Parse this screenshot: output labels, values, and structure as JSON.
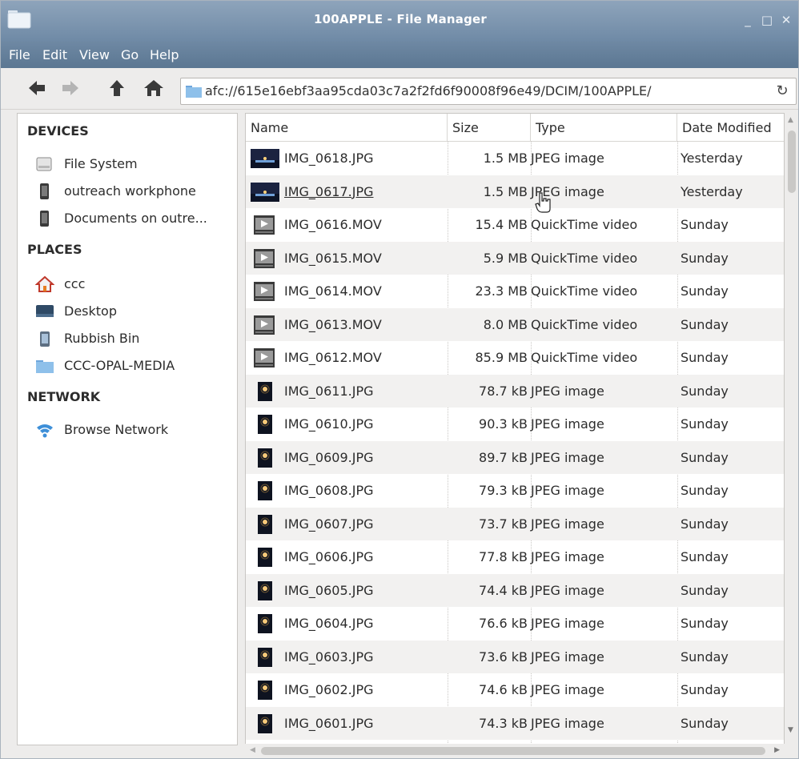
{
  "window": {
    "title": "100APPLE - File Manager",
    "min_glyph": "_",
    "max_glyph": "□",
    "close_glyph": "✕"
  },
  "menubar": {
    "items": [
      "File",
      "Edit",
      "View",
      "Go",
      "Help"
    ]
  },
  "toolbar": {
    "back_icon": "back-arrow-icon",
    "forward_icon": "forward-arrow-icon",
    "up_icon": "up-arrow-icon",
    "home_icon": "home-icon",
    "address": "afc://615e16ebf3aa95cda03c7a2f2fd6f90008f96e49/DCIM/100APPLE/",
    "reload_glyph": "↻"
  },
  "sidebar": {
    "devices_heading": "DEVICES",
    "devices": [
      {
        "label": "File System",
        "icon": "drive-icon"
      },
      {
        "label": "outreach workphone",
        "icon": "phone-icon"
      },
      {
        "label": "Documents on outre...",
        "icon": "phone-icon"
      }
    ],
    "places_heading": "PLACES",
    "places": [
      {
        "label": "ccc",
        "icon": "home-icon"
      },
      {
        "label": "Desktop",
        "icon": "desktop-icon"
      },
      {
        "label": "Rubbish Bin",
        "icon": "trash-icon"
      },
      {
        "label": "CCC-OPAL-MEDIA",
        "icon": "folder-icon"
      }
    ],
    "network_heading": "NETWORK",
    "network": [
      {
        "label": "Browse Network",
        "icon": "wifi-icon"
      }
    ]
  },
  "columns": {
    "name": "Name",
    "size": "Size",
    "type": "Type",
    "date": "Date Modified"
  },
  "files": [
    {
      "name": "IMG_0618.JPG",
      "size": "1.5 MB",
      "type": "JPEG image",
      "date": "Yesterday",
      "thumb": "landscape"
    },
    {
      "name": "IMG_0617.JPG",
      "size": "1.5 MB",
      "type": "JPEG image",
      "date": "Yesterday",
      "thumb": "landscape"
    },
    {
      "name": "IMG_0616.MOV",
      "size": "15.4 MB",
      "type": "QuickTime video",
      "date": "Sunday",
      "thumb": "video"
    },
    {
      "name": "IMG_0615.MOV",
      "size": "5.9 MB",
      "type": "QuickTime video",
      "date": "Sunday",
      "thumb": "video"
    },
    {
      "name": "IMG_0614.MOV",
      "size": "23.3 MB",
      "type": "QuickTime video",
      "date": "Sunday",
      "thumb": "video"
    },
    {
      "name": "IMG_0613.MOV",
      "size": "8.0 MB",
      "type": "QuickTime video",
      "date": "Sunday",
      "thumb": "video"
    },
    {
      "name": "IMG_0612.MOV",
      "size": "85.9 MB",
      "type": "QuickTime video",
      "date": "Sunday",
      "thumb": "video"
    },
    {
      "name": "IMG_0611.JPG",
      "size": "78.7 kB",
      "type": "JPEG image",
      "date": "Sunday",
      "thumb": "portrait"
    },
    {
      "name": "IMG_0610.JPG",
      "size": "90.3 kB",
      "type": "JPEG image",
      "date": "Sunday",
      "thumb": "portrait"
    },
    {
      "name": "IMG_0609.JPG",
      "size": "89.7 kB",
      "type": "JPEG image",
      "date": "Sunday",
      "thumb": "portrait"
    },
    {
      "name": "IMG_0608.JPG",
      "size": "79.3 kB",
      "type": "JPEG image",
      "date": "Sunday",
      "thumb": "portrait"
    },
    {
      "name": "IMG_0607.JPG",
      "size": "73.7 kB",
      "type": "JPEG image",
      "date": "Sunday",
      "thumb": "portrait"
    },
    {
      "name": "IMG_0606.JPG",
      "size": "77.8 kB",
      "type": "JPEG image",
      "date": "Sunday",
      "thumb": "portrait"
    },
    {
      "name": "IMG_0605.JPG",
      "size": "74.4 kB",
      "type": "JPEG image",
      "date": "Sunday",
      "thumb": "portrait"
    },
    {
      "name": "IMG_0604.JPG",
      "size": "76.6 kB",
      "type": "JPEG image",
      "date": "Sunday",
      "thumb": "portrait"
    },
    {
      "name": "IMG_0603.JPG",
      "size": "73.6 kB",
      "type": "JPEG image",
      "date": "Sunday",
      "thumb": "portrait"
    },
    {
      "name": "IMG_0602.JPG",
      "size": "74.6 kB",
      "type": "JPEG image",
      "date": "Sunday",
      "thumb": "portrait"
    },
    {
      "name": "IMG_0601.JPG",
      "size": "74.3 kB",
      "type": "JPEG image",
      "date": "Sunday",
      "thumb": "portrait"
    }
  ],
  "hovered_file": "IMG_0617.JPG",
  "colors": {
    "titlebar": "#7d96b0",
    "menubar": "#6580a0",
    "row_alt": "#f2f1f0"
  }
}
